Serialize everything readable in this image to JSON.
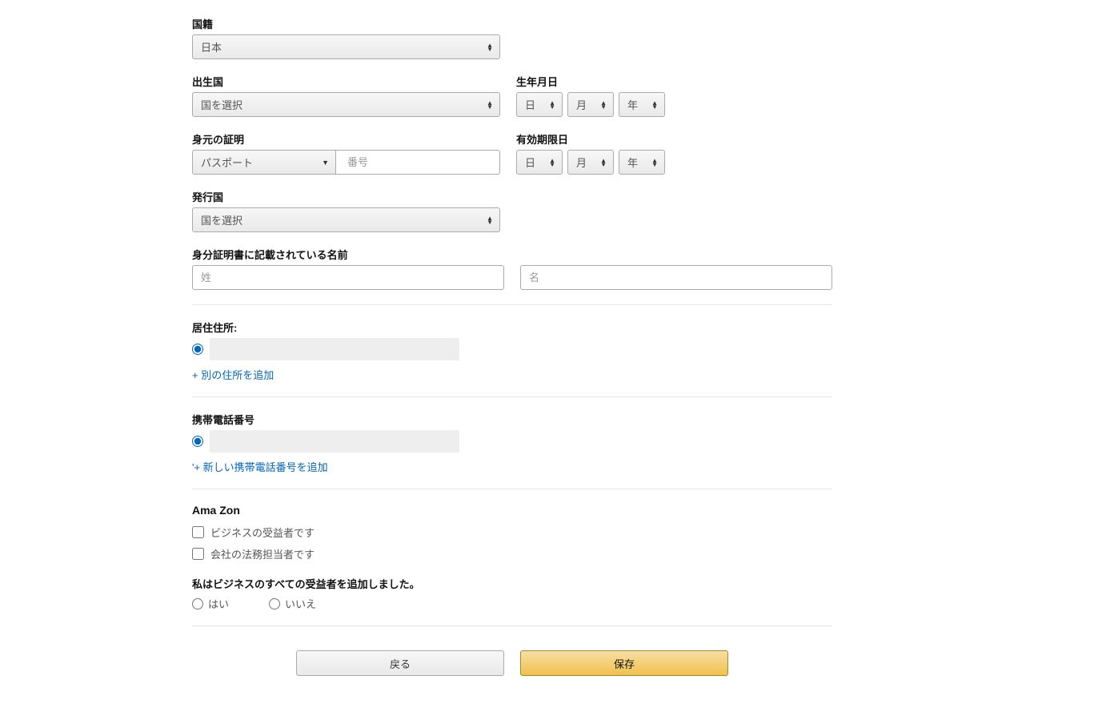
{
  "nationality": {
    "label": "国籍",
    "value": "日本"
  },
  "birthCountry": {
    "label": "出生国",
    "value": "国を選択"
  },
  "dob": {
    "label": "生年月日",
    "day": "日",
    "month": "月",
    "year": "年"
  },
  "identity": {
    "label": "身元の証明",
    "type": "パスポート",
    "numberPlaceholder": "番号"
  },
  "expiry": {
    "label": "有効期限日",
    "day": "日",
    "month": "月",
    "year": "年"
  },
  "issuingCountry": {
    "label": "発行国",
    "value": "国を選択"
  },
  "idName": {
    "label": "身分証明書に記載されている名前",
    "lastPlaceholder": "姓",
    "firstPlaceholder": "名"
  },
  "address": {
    "label": "居住住所:",
    "addLink": "+ 別の住所を追加"
  },
  "phone": {
    "label": "携帯電話番号",
    "addLink": "'+ 新しい携帯電話番号を追加"
  },
  "amazon": {
    "heading": "Ama Zon",
    "beneficiary": "ビジネスの受益者です",
    "legal": "会社の法務担当者です"
  },
  "confirm": {
    "label": "私はビジネスのすべての受益者を追加しました。",
    "yes": "はい",
    "no": "いいえ"
  },
  "buttons": {
    "back": "戻る",
    "save": "保存"
  }
}
